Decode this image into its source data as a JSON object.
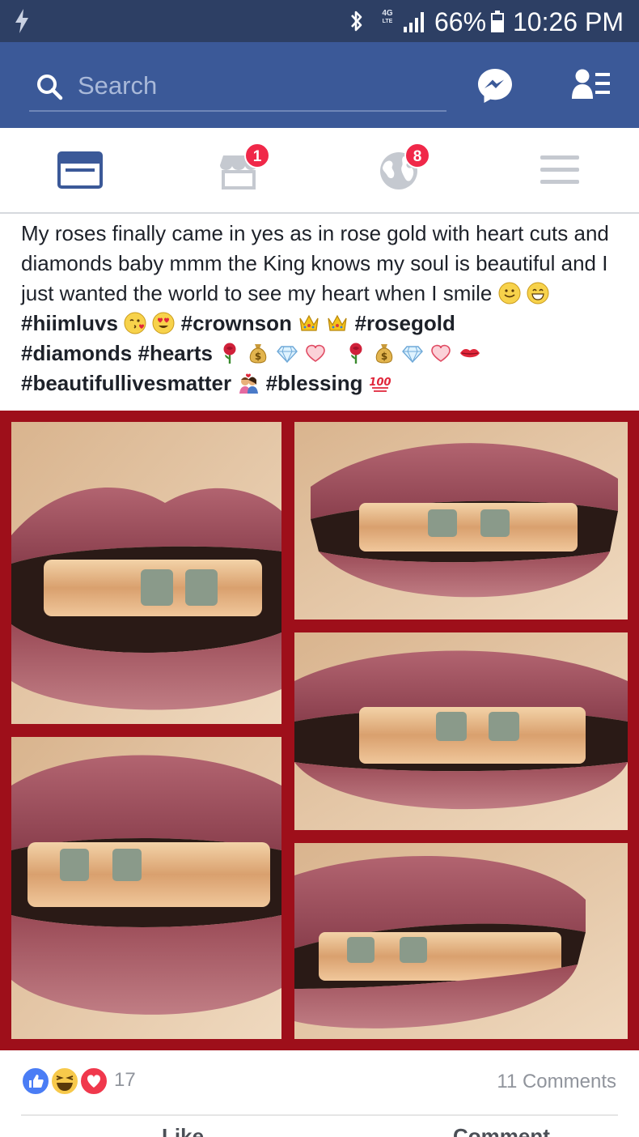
{
  "status_bar": {
    "network": "4G",
    "network_sub": "LTE",
    "battery": "66%",
    "time": "10:26 PM"
  },
  "header": {
    "search_placeholder": "Search"
  },
  "tabs": {
    "marketplace_badge": "1",
    "notifications_badge": "8"
  },
  "post": {
    "line1": "My roses finally came in yes as in rose gold with heart cuts and diamonds baby mmm the King knows my soul is beautiful and I just wanted the world to see my heart when I smile",
    "tag_hiimluvs": "#hiimluvs",
    "tag_crownson": "#crownson",
    "tag_rosegold": "#rosegold",
    "tag_diamonds": "#diamonds",
    "tag_hearts": "#hearts",
    "tag_beautifullivesmatter": "#beautifullivesmatter",
    "tag_blessing": "#blessing",
    "emoji": {
      "smile": "🙂",
      "grin": "😄",
      "kiss": "😘",
      "heart_eyes": "😍",
      "crown": "👑",
      "rose": "🌹",
      "moneybag": "💰",
      "gem": "💎",
      "heart": "🤍",
      "lips": "💋",
      "couple": "💑",
      "hundred": "💯"
    }
  },
  "reactions": {
    "count": "17",
    "comments": "11 Comments",
    "like_color": "#4a7df5",
    "haha_color": "#f7c94b",
    "love_color": "#f0384c"
  },
  "actions": {
    "like": "Like",
    "comment": "Comment"
  }
}
